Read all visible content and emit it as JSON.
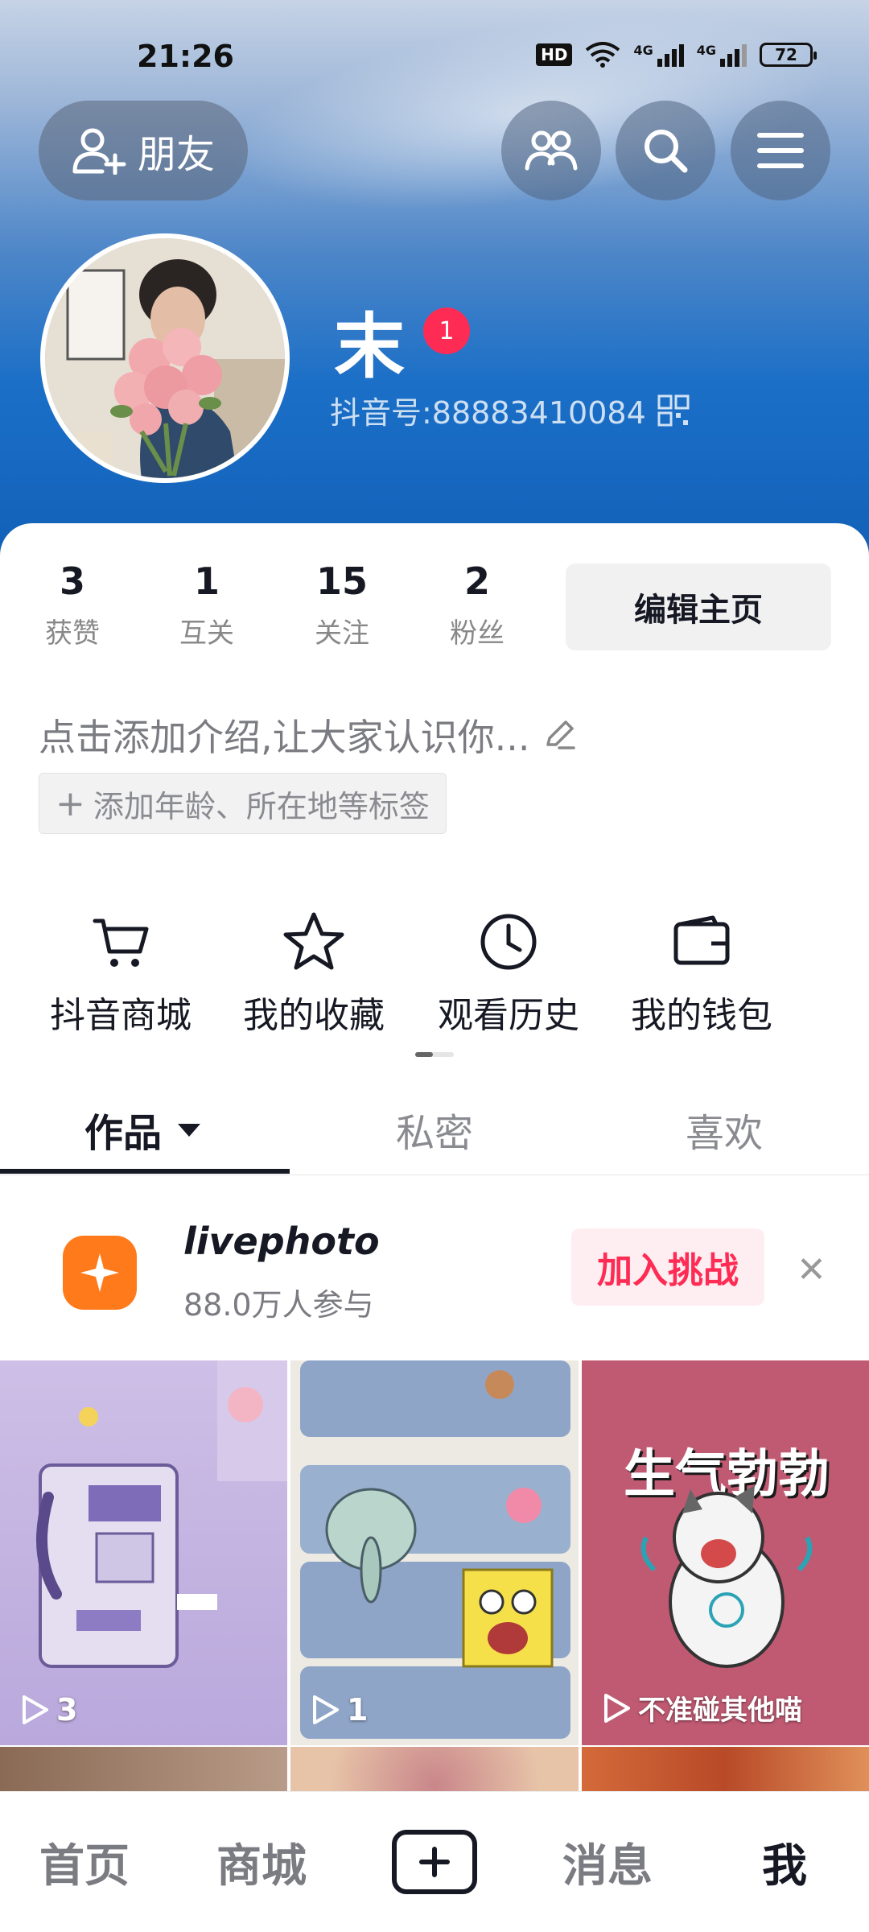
{
  "status_bar": {
    "time": "21:26",
    "hd": "HD",
    "signal1": "4G",
    "signal2": "4G",
    "battery": "72"
  },
  "top_bar": {
    "friends_label": "朋友"
  },
  "profile": {
    "nickname": "末",
    "badge_count": "1",
    "douyin_id": "抖音号:88883410084"
  },
  "stats": [
    {
      "num": "3",
      "label": "获赞"
    },
    {
      "num": "1",
      "label": "互关"
    },
    {
      "num": "15",
      "label": "关注"
    },
    {
      "num": "2",
      "label": "粉丝"
    }
  ],
  "edit_button": "编辑主页",
  "bio_placeholder": "点击添加介绍,让大家认识你...",
  "tag_add": "添加年龄、所在地等标签",
  "shortcuts": [
    {
      "label": "抖音商城",
      "icon": "cart-icon"
    },
    {
      "label": "我的收藏",
      "icon": "star-icon"
    },
    {
      "label": "观看历史",
      "icon": "clock-icon"
    },
    {
      "label": "我的钱包",
      "icon": "wallet-icon"
    }
  ],
  "tabs": [
    {
      "label": "作品"
    },
    {
      "label": "私密"
    },
    {
      "label": "喜欢"
    }
  ],
  "promo": {
    "title": "livephoto",
    "subtitle": "88.0万人参与",
    "button": "加入挑战"
  },
  "videos": [
    {
      "plays": "3",
      "caption": ""
    },
    {
      "plays": "1",
      "caption": ""
    },
    {
      "plays": "",
      "caption": "不准碰其他喵",
      "title_art": "生气勃勃"
    }
  ],
  "bottom_nav": {
    "home": "首页",
    "mall": "商城",
    "messages": "消息",
    "me": "我"
  },
  "colors": {
    "accent": "#fe2c55",
    "promo_orange": "#ff7a1a",
    "hero_blue": "#1b6fc7"
  }
}
